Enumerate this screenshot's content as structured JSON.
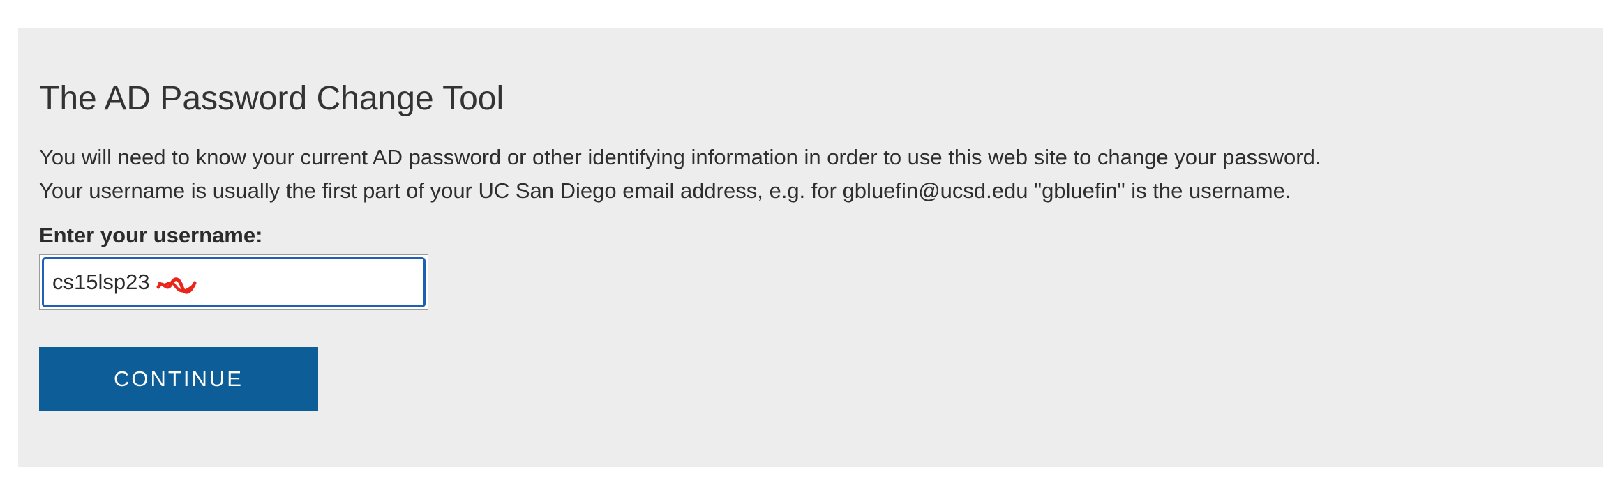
{
  "page": {
    "title": "The AD Password Change Tool",
    "intro_lines": [
      "You will need to know your current AD password or other identifying information in order to use this web site to change your password.",
      "Your username is usually the first part of your UC San Diego email address, e.g. for gbluefin@ucsd.edu \"gbluefin\" is the username."
    ]
  },
  "form": {
    "username_label": "Enter your username:",
    "username_value": "cs15lsp23",
    "redaction_color": "#e8261c",
    "submit_label": "CONTINUE"
  },
  "colors": {
    "panel_bg": "#ededed",
    "button_bg": "#0d5e98",
    "input_focus_border": "#1f5fb6"
  }
}
